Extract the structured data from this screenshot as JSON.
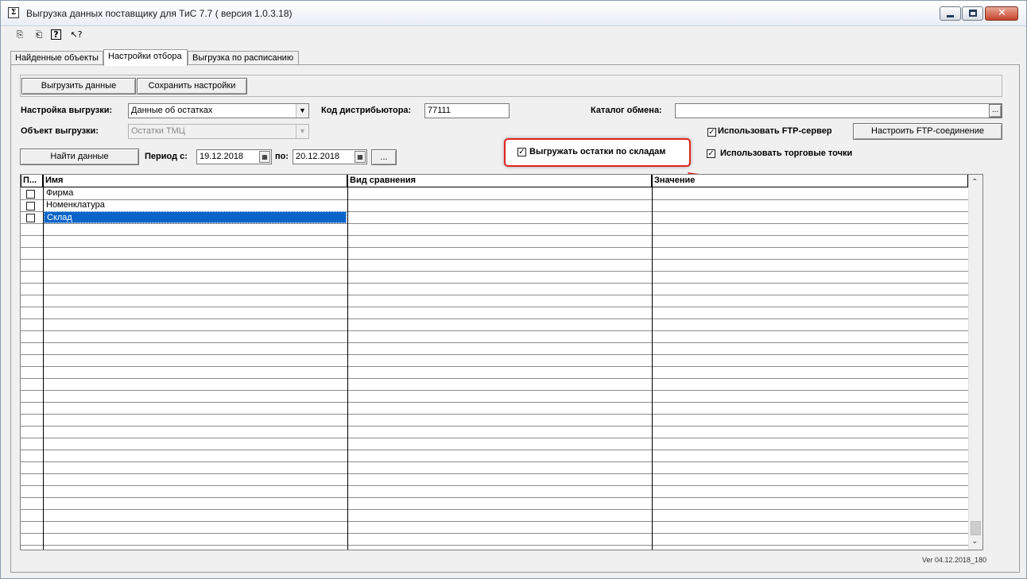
{
  "window": {
    "title": "Выгрузка данных поставщику для ТиС 7.7 ( версия 1.0.3.18)",
    "app_icon_glyph": "Σ"
  },
  "toolbar": {
    "icons": [
      "lock-out-icon",
      "lock-in-icon",
      "help-icon",
      "whats-this-icon"
    ],
    "glyphs": [
      "⎘",
      "⎗",
      "?",
      "↖?"
    ]
  },
  "tabs": [
    {
      "label": "Найденные объекты"
    },
    {
      "label": "Настройки отбора"
    },
    {
      "label": "Выгрузка по расписанию"
    }
  ],
  "buttons": {
    "export_data": "Выгрузить данные",
    "save_settings": "Сохранить настройки",
    "find_data": "Найти данные",
    "ellipsis": "...",
    "configure_ftp": "Настроить FTP-соединение",
    "browse": "..."
  },
  "form": {
    "export_setting_label": "Настройка выгрузки:",
    "export_setting_value": "Данные об остатках",
    "export_object_label": "Объект выгрузки:",
    "export_object_value": "Остатки ТМЦ",
    "distributor_code_label": "Код дистрибьютора:",
    "distributor_code_value": "77111",
    "exchange_catalog_label": "Каталог обмена:",
    "exchange_catalog_value": "",
    "period_from_label": "Период с:",
    "period_from_value": "19.12.2018",
    "period_to_label": "по:",
    "period_to_value": "20.12.2018"
  },
  "checkboxes": {
    "use_ftp": {
      "label": "Использовать FTP-сервер",
      "checked": true
    },
    "export_by_warehouse": {
      "label": "Выгружать остатки по складам",
      "checked": true
    },
    "use_trade_points": {
      "label": "Использовать торговые точки",
      "checked": true
    }
  },
  "grid": {
    "columns": [
      "П...",
      "Имя",
      "Вид сравнения",
      "Значение"
    ],
    "rows": [
      {
        "name": "Фирма",
        "checked": false
      },
      {
        "name": "Номенклатура",
        "checked": false
      },
      {
        "name": "Склад",
        "checked": false,
        "selected": true
      }
    ]
  },
  "footer": {
    "version": "Ver 04.12.2018_180"
  },
  "colors": {
    "highlight_border": "#e1251b",
    "selection": "#0a64c8"
  }
}
